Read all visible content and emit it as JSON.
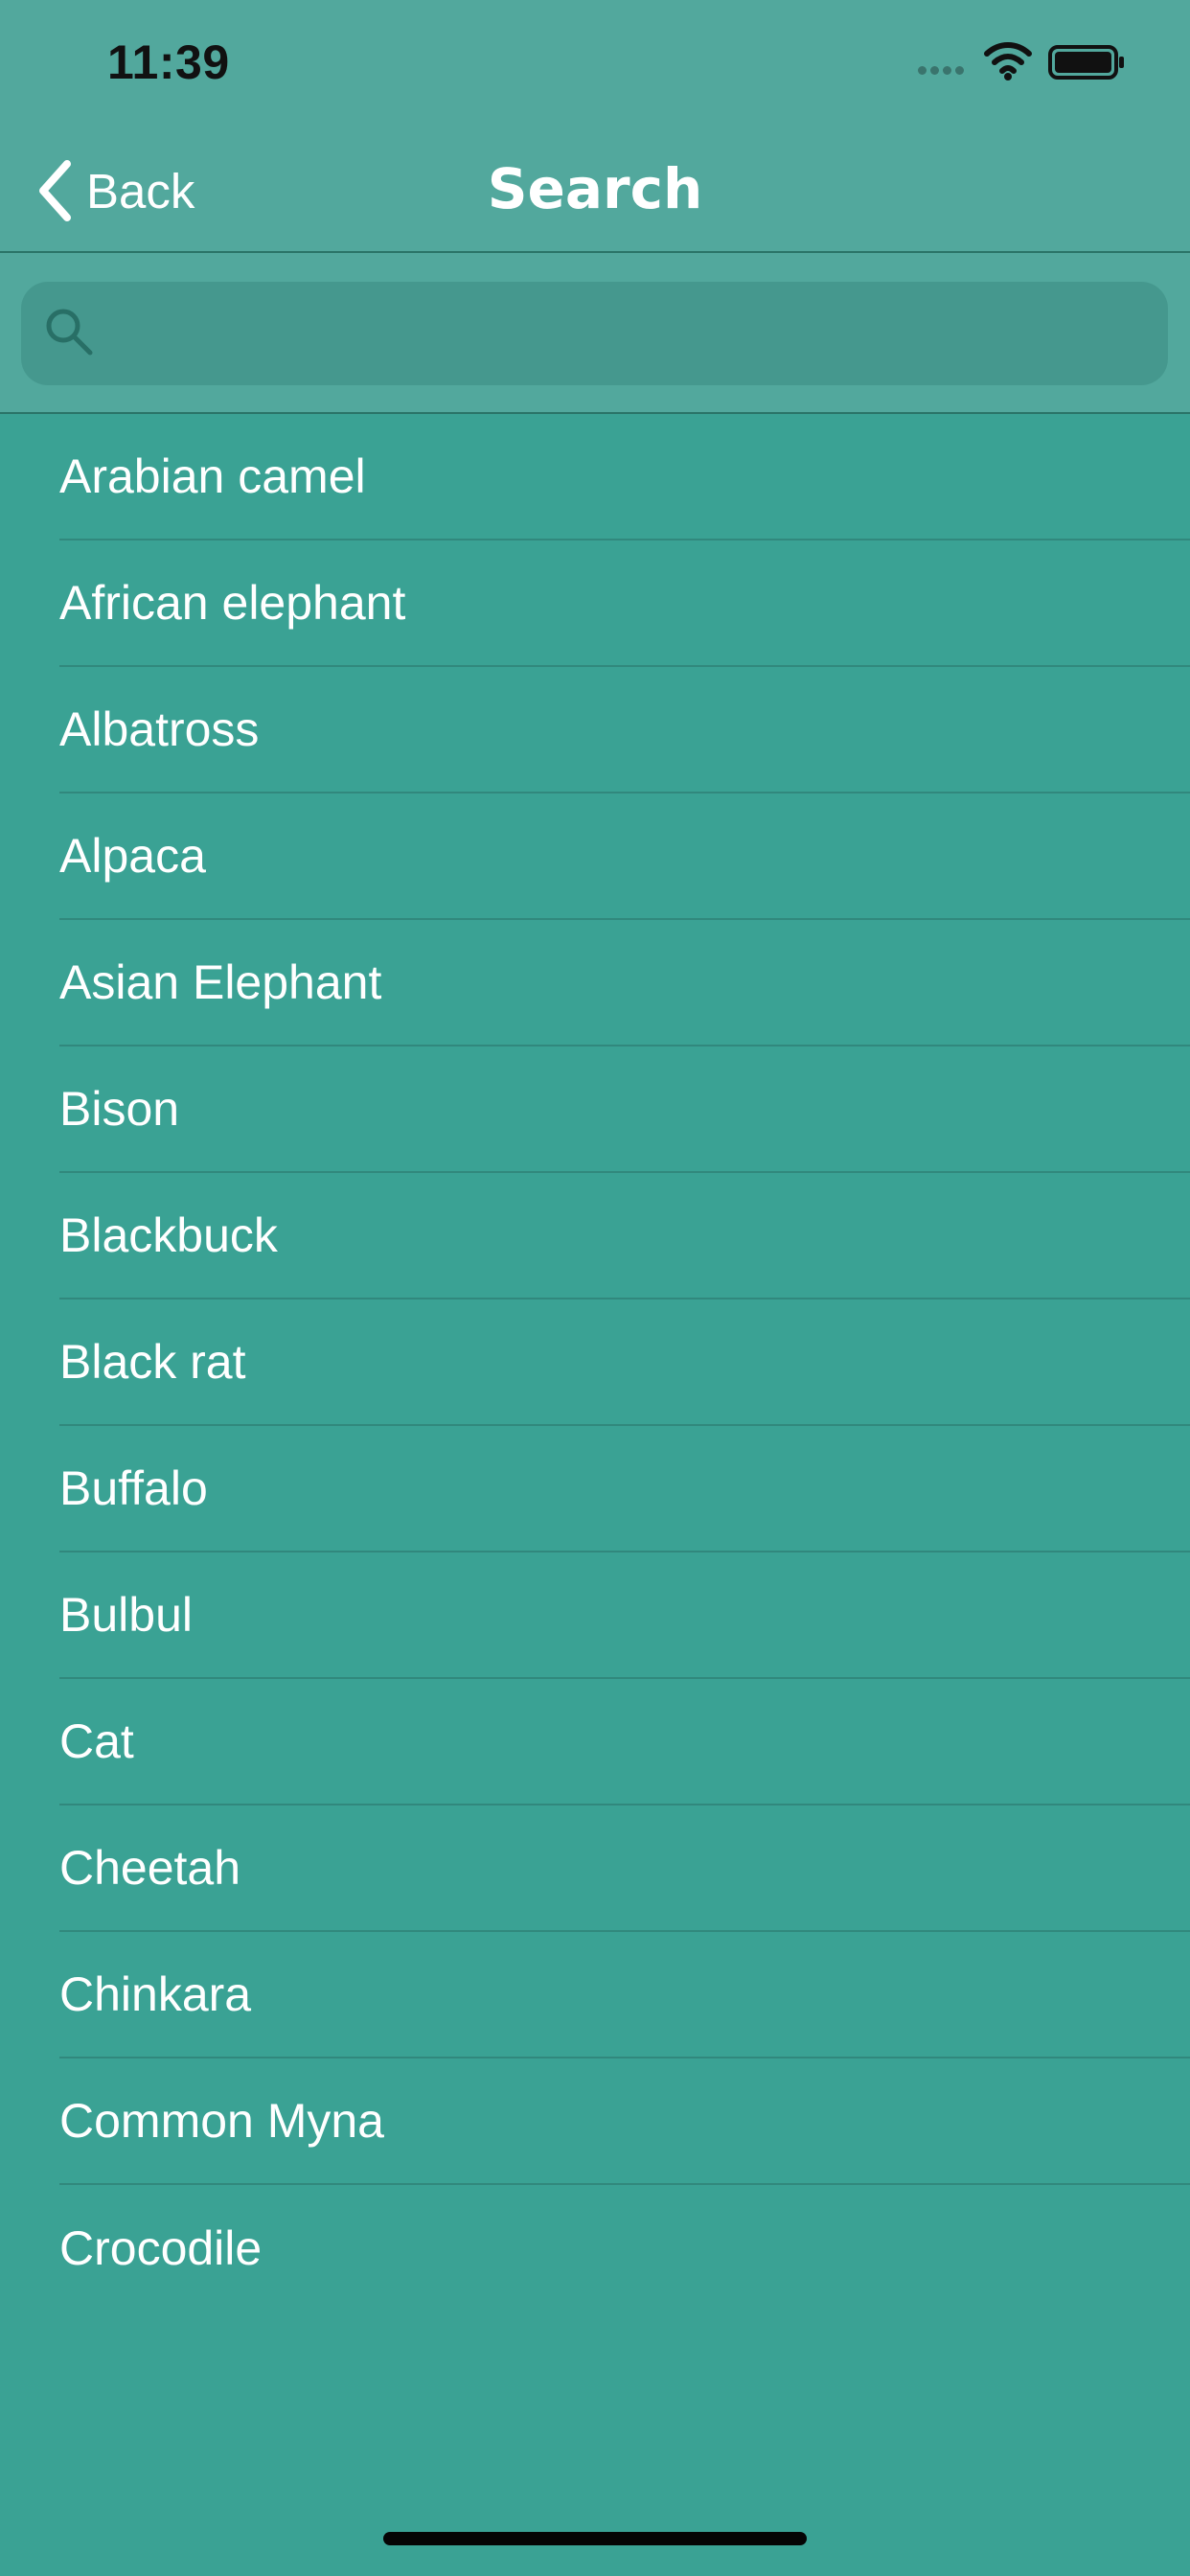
{
  "status_bar": {
    "time": "11:39",
    "icons": [
      "cellular-signal-icon",
      "wifi-icon",
      "battery-icon"
    ]
  },
  "navigation": {
    "back_label": "Back",
    "title": "Search",
    "back_icon": "chevron-left-icon"
  },
  "search": {
    "placeholder": "",
    "value": "",
    "icon": "magnifier-icon"
  },
  "animals": [
    "Arabian camel",
    "African elephant",
    "Albatross",
    "Alpaca",
    "Asian Elephant",
    "Bison",
    "Blackbuck",
    "Black rat",
    "Buffalo",
    "Bulbul",
    "Cat",
    "Cheetah",
    "Chinkara",
    "Common Myna",
    "Crocodile"
  ],
  "colors": {
    "background": "#3aa294",
    "header": "#52a89d",
    "search_field": "#45988e",
    "text": "#ffffff",
    "separator": "#31887d"
  }
}
